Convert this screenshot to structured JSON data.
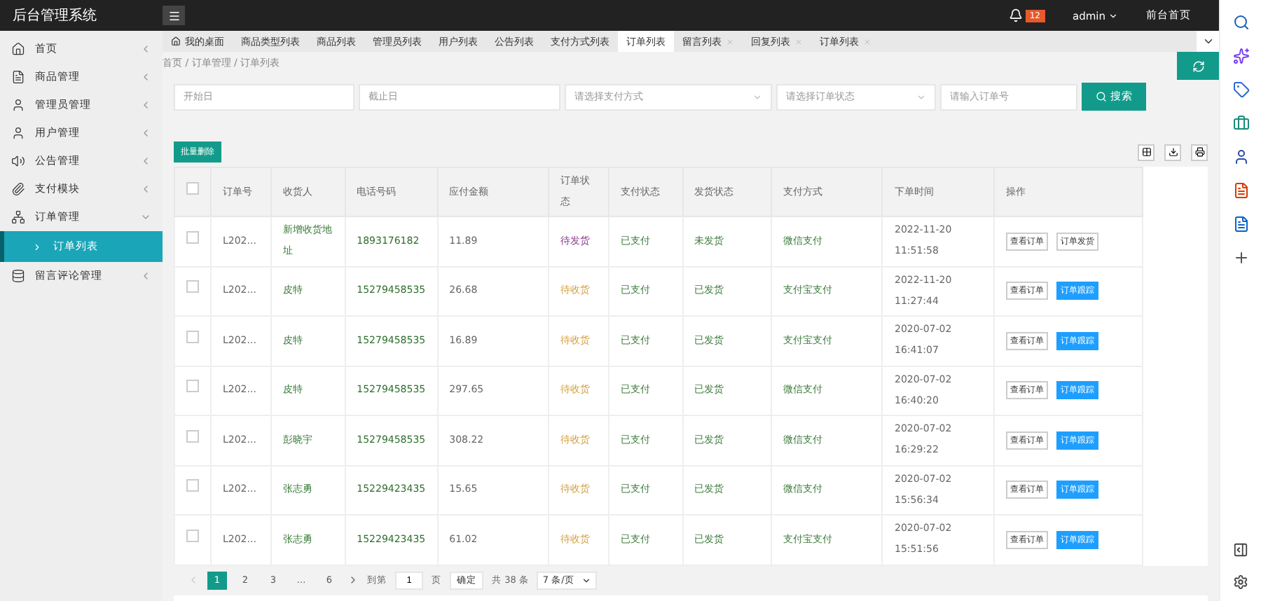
{
  "app_title": "后台管理系统",
  "header": {
    "badge": "12",
    "user": "admin",
    "front_link": "前台首页"
  },
  "sidebar": [
    {
      "label": "首页",
      "expanded": false
    },
    {
      "label": "商品管理",
      "expanded": false
    },
    {
      "label": "管理员管理",
      "expanded": false
    },
    {
      "label": "用户管理",
      "expanded": false
    },
    {
      "label": "公告管理",
      "expanded": false
    },
    {
      "label": "支付模块",
      "expanded": false
    },
    {
      "label": "订单管理",
      "expanded": true,
      "children": [
        {
          "label": "订单列表",
          "selected": true
        }
      ]
    },
    {
      "label": "留言评论管理",
      "expanded": false
    }
  ],
  "tabs": [
    {
      "label": "我的桌面",
      "selected": false,
      "closable": false
    },
    {
      "label": "商品类型列表",
      "selected": false,
      "closable": false
    },
    {
      "label": "商品列表",
      "selected": false,
      "closable": false
    },
    {
      "label": "管理员列表",
      "selected": false,
      "closable": false
    },
    {
      "label": "用户列表",
      "selected": false,
      "closable": false
    },
    {
      "label": "公告列表",
      "selected": false,
      "closable": false
    },
    {
      "label": "支付方式列表",
      "selected": false,
      "closable": false
    },
    {
      "label": "订单列表",
      "selected": true,
      "closable": false
    },
    {
      "label": "留言列表",
      "selected": false,
      "closable": true
    },
    {
      "label": "回复列表",
      "selected": false,
      "closable": true
    },
    {
      "label": "订单列表",
      "selected": false,
      "closable": true
    }
  ],
  "breadcrumb": "首页 / 订单管理 / 订单列表",
  "filters": [
    {
      "kind": "input",
      "placeholder": "开始日"
    },
    {
      "kind": "input",
      "placeholder": "截止日"
    },
    {
      "kind": "select",
      "placeholder": "请选择支付方式"
    },
    {
      "kind": "select",
      "placeholder": "请选择订单状态"
    },
    {
      "kind": "input",
      "placeholder": "请输入订单号"
    }
  ],
  "search_button": "搜索",
  "batch_delete": "批量删除",
  "table": {
    "all_checked": false,
    "columns": [
      "订单号",
      "收货人",
      "电话号码",
      "应付金额",
      "订单状态",
      "支付状态",
      "发货状态",
      "支付方式",
      "下单时间",
      "操作"
    ],
    "rows": [
      {
        "checked": false,
        "order": "L202...",
        "receiver": "新增收货地址",
        "phone": "1893176182",
        "amount": "11.89",
        "status": {
          "text": "待发货",
          "color": "#8a3a8a"
        },
        "pay": "已支付",
        "ship": "未发货",
        "method": "微信支付",
        "date": "2022-11-20",
        "time": "11:51:58",
        "actions": [
          {
            "label": "查看订单",
            "kind": "outline"
          },
          {
            "label": "订单发货",
            "kind": "outline"
          }
        ]
      },
      {
        "checked": false,
        "order": "L202...",
        "receiver": "皮特",
        "phone": "15279458535",
        "amount": "26.68",
        "status": {
          "text": "待收货",
          "color": "#d4a040"
        },
        "pay": "已支付",
        "ship": "已发货",
        "method": "支付宝支付",
        "date": "2022-11-20",
        "time": "11:27:44",
        "actions": [
          {
            "label": "查看订单",
            "kind": "outline"
          },
          {
            "label": "订单跟踪",
            "kind": "primary"
          }
        ]
      },
      {
        "checked": false,
        "order": "L202...",
        "receiver": "皮特",
        "phone": "15279458535",
        "amount": "16.89",
        "status": {
          "text": "待收货",
          "color": "#d4a040"
        },
        "pay": "已支付",
        "ship": "已发货",
        "method": "支付宝支付",
        "date": "2020-07-02",
        "time": "16:41:07",
        "actions": [
          {
            "label": "查看订单",
            "kind": "outline"
          },
          {
            "label": "订单跟踪",
            "kind": "primary"
          }
        ]
      },
      {
        "checked": false,
        "order": "L202...",
        "receiver": "皮特",
        "phone": "15279458535",
        "amount": "297.65",
        "status": {
          "text": "待收货",
          "color": "#d4a040"
        },
        "pay": "已支付",
        "ship": "已发货",
        "method": "微信支付",
        "date": "2020-07-02",
        "time": "16:40:20",
        "actions": [
          {
            "label": "查看订单",
            "kind": "outline"
          },
          {
            "label": "订单跟踪",
            "kind": "primary"
          }
        ]
      },
      {
        "checked": false,
        "order": "L202...",
        "receiver": "彭晓宇",
        "phone": "15279458535",
        "amount": "308.22",
        "status": {
          "text": "待收货",
          "color": "#d4a040"
        },
        "pay": "已支付",
        "ship": "已发货",
        "method": "微信支付",
        "date": "2020-07-02",
        "time": "16:29:22",
        "actions": [
          {
            "label": "查看订单",
            "kind": "outline"
          },
          {
            "label": "订单跟踪",
            "kind": "primary"
          }
        ]
      },
      {
        "checked": false,
        "order": "L202...",
        "receiver": "张志勇",
        "phone": "15229423435",
        "amount": "15.65",
        "status": {
          "text": "待收货",
          "color": "#d4a040"
        },
        "pay": "已支付",
        "ship": "已发货",
        "method": "微信支付",
        "date": "2020-07-02",
        "time": "15:56:34",
        "actions": [
          {
            "label": "查看订单",
            "kind": "outline"
          },
          {
            "label": "订单跟踪",
            "kind": "primary"
          }
        ]
      },
      {
        "checked": false,
        "order": "L202...",
        "receiver": "张志勇",
        "phone": "15229423435",
        "amount": "61.02",
        "status": {
          "text": "待收货",
          "color": "#d4a040"
        },
        "pay": "已支付",
        "ship": "已发货",
        "method": "支付宝支付",
        "date": "2020-07-02",
        "time": "15:51:56",
        "actions": [
          {
            "label": "查看订单",
            "kind": "outline"
          },
          {
            "label": "订单跟踪",
            "kind": "primary"
          }
        ]
      }
    ]
  },
  "pagination": {
    "pages": [
      {
        "label": "1",
        "selected": true
      },
      {
        "label": "2",
        "selected": false
      },
      {
        "label": "3",
        "selected": false
      },
      {
        "label": "…",
        "selected": false
      },
      {
        "label": "6",
        "selected": false
      }
    ],
    "goto_label": "到第",
    "goto_value": "1",
    "page_unit": "页",
    "confirm": "确定",
    "total": "共 38 条",
    "page_size": "7 条/页"
  }
}
